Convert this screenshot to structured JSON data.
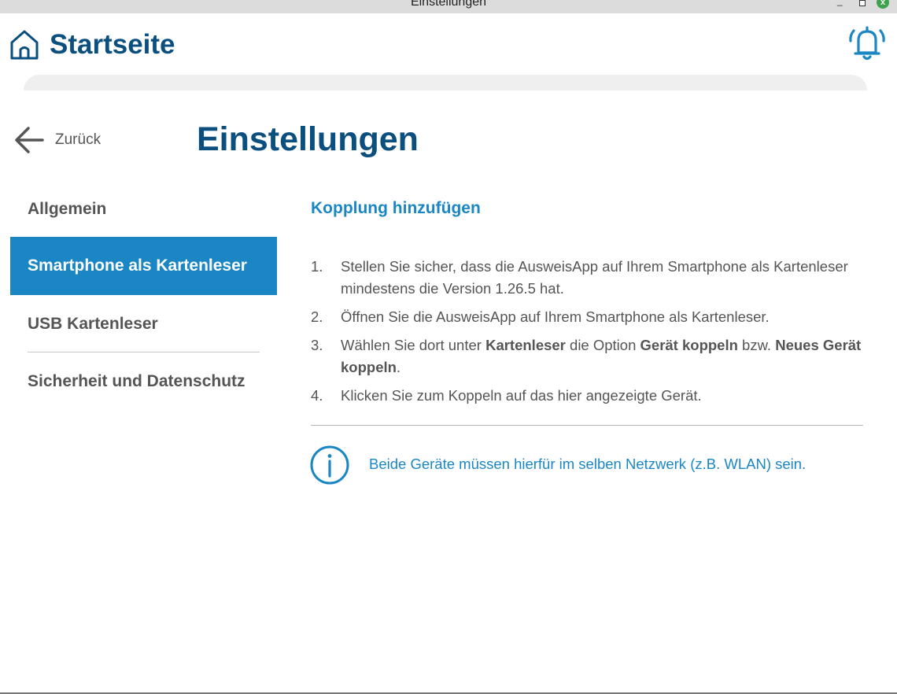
{
  "window": {
    "title": "Einstellungen",
    "minimize": "_",
    "close": "x"
  },
  "header": {
    "home_label": "Startseite"
  },
  "navigation": {
    "back_label": "Zurück"
  },
  "page": {
    "title": "Einstellungen"
  },
  "sidebar": {
    "items": [
      {
        "label": "Allgemein",
        "active": false
      },
      {
        "label": "Smartphone als Kartenleser",
        "active": true
      },
      {
        "label": "USB Kartenleser",
        "active": false
      },
      {
        "label": "Sicherheit und Datenschutz",
        "active": false
      }
    ]
  },
  "content": {
    "section_title": "Kopplung hinzufügen",
    "steps": [
      {
        "num": "1.",
        "parts": [
          {
            "text": "Stellen Sie sicher, dass die AusweisApp auf Ihrem Smartphone als Kartenleser mindestens die Version 1.26.5 hat."
          }
        ]
      },
      {
        "num": "2.",
        "parts": [
          {
            "text": "Öffnen Sie die AusweisApp auf Ihrem Smartphone als Kartenleser."
          }
        ]
      },
      {
        "num": "3.",
        "parts": [
          {
            "text": "Wählen Sie dort unter "
          },
          {
            "text": "Kartenleser",
            "bold": true
          },
          {
            "text": " die Option "
          },
          {
            "text": "Gerät koppeln",
            "bold": true
          },
          {
            "text": " bzw. "
          },
          {
            "text": "Neues Gerät koppeln",
            "bold": true
          },
          {
            "text": "."
          }
        ]
      },
      {
        "num": "4.",
        "parts": [
          {
            "text": "Klicken Sie zum Koppeln auf das hier angezeigte Gerät."
          }
        ]
      }
    ],
    "info_text": "Beide Geräte müssen hierfür im selben Netzwerk (z.B. WLAN) sein."
  },
  "colors": {
    "primary_dark": "#0b4f7f",
    "accent": "#1a87c4",
    "text_gray": "#555555"
  },
  "icons": {
    "home": "home-icon",
    "notification": "bell-icon",
    "back": "arrow-left-icon",
    "info": "info-icon"
  }
}
